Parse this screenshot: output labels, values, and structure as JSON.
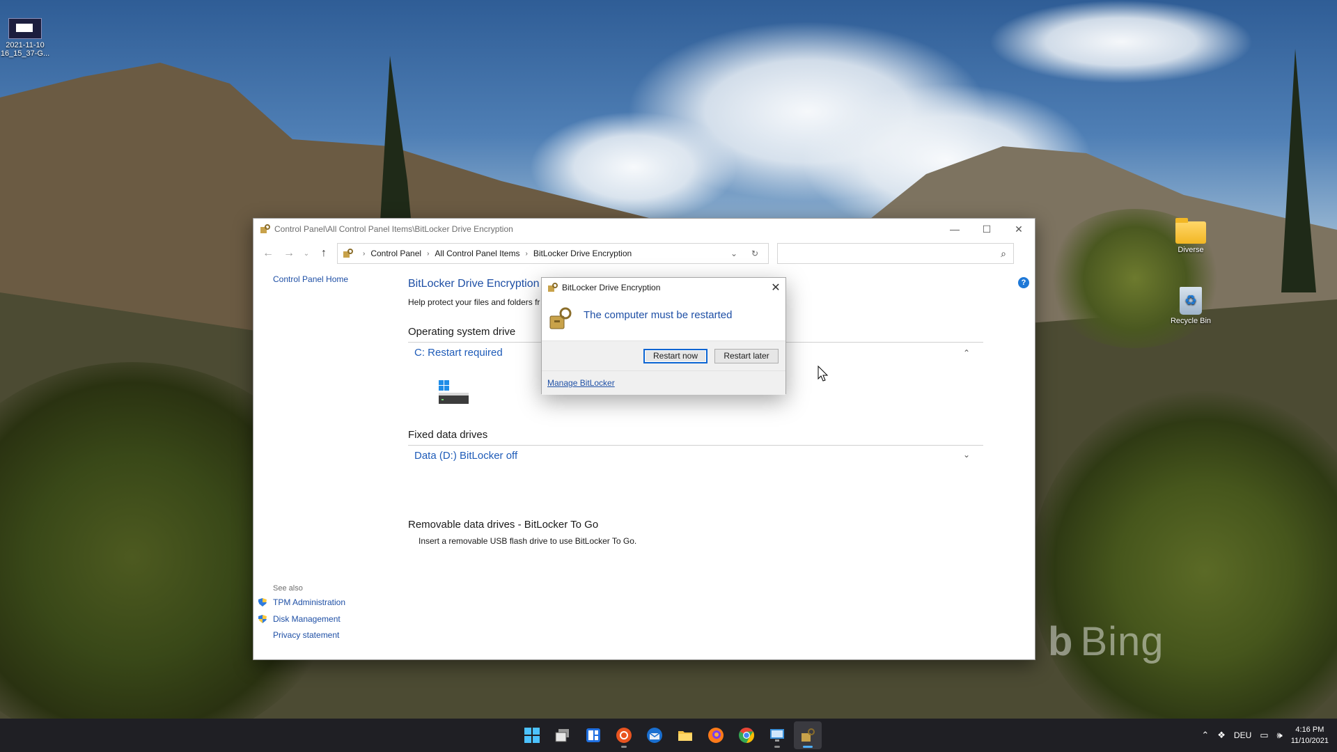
{
  "desktop": {
    "icons": [
      {
        "label": "2021-11-10\n16_15_37-G..."
      },
      {
        "label": "Diverse"
      },
      {
        "label": "Recycle Bin"
      }
    ],
    "watermark": "Bing"
  },
  "window": {
    "title": "Control Panel\\All Control Panel Items\\BitLocker Drive Encryption",
    "breadcrumbs": [
      "Control Panel",
      "All Control Panel Items",
      "BitLocker Drive Encryption"
    ],
    "search_placeholder": ""
  },
  "left_pane": {
    "home_link": "Control Panel Home",
    "see_also_heading": "See also",
    "links": [
      "TPM Administration",
      "Disk Management",
      "Privacy statement"
    ]
  },
  "main": {
    "heading": "BitLocker Drive Encryption",
    "description": "Help protect your files and folders fr",
    "os_section_title": "Operating system drive",
    "os_drive_label": "C: Restart required",
    "fixed_section_title": "Fixed data drives",
    "fixed_drive_label": "Data (D:) BitLocker off",
    "removable_section_title": "Removable data drives - BitLocker To Go",
    "removable_note": "Insert a removable USB flash drive to use BitLocker To Go."
  },
  "dialog": {
    "title": "BitLocker Drive Encryption",
    "message": "The computer must be restarted",
    "restart_now": "Restart now",
    "restart_later": "Restart later",
    "manage_link": "Manage BitLocker"
  },
  "taskbar": {
    "apps": [
      "start",
      "task-view",
      "widgets",
      "ubuntu",
      "thunderbird",
      "file-explorer",
      "firefox",
      "chrome",
      "remote-desktop",
      "bitlocker"
    ],
    "language": "DEU",
    "time": "4:16 PM",
    "date": "11/10/2021"
  },
  "colors": {
    "link": "#1e4fa5",
    "accent": "#0a64d2",
    "taskbar": "#1f1f24"
  }
}
